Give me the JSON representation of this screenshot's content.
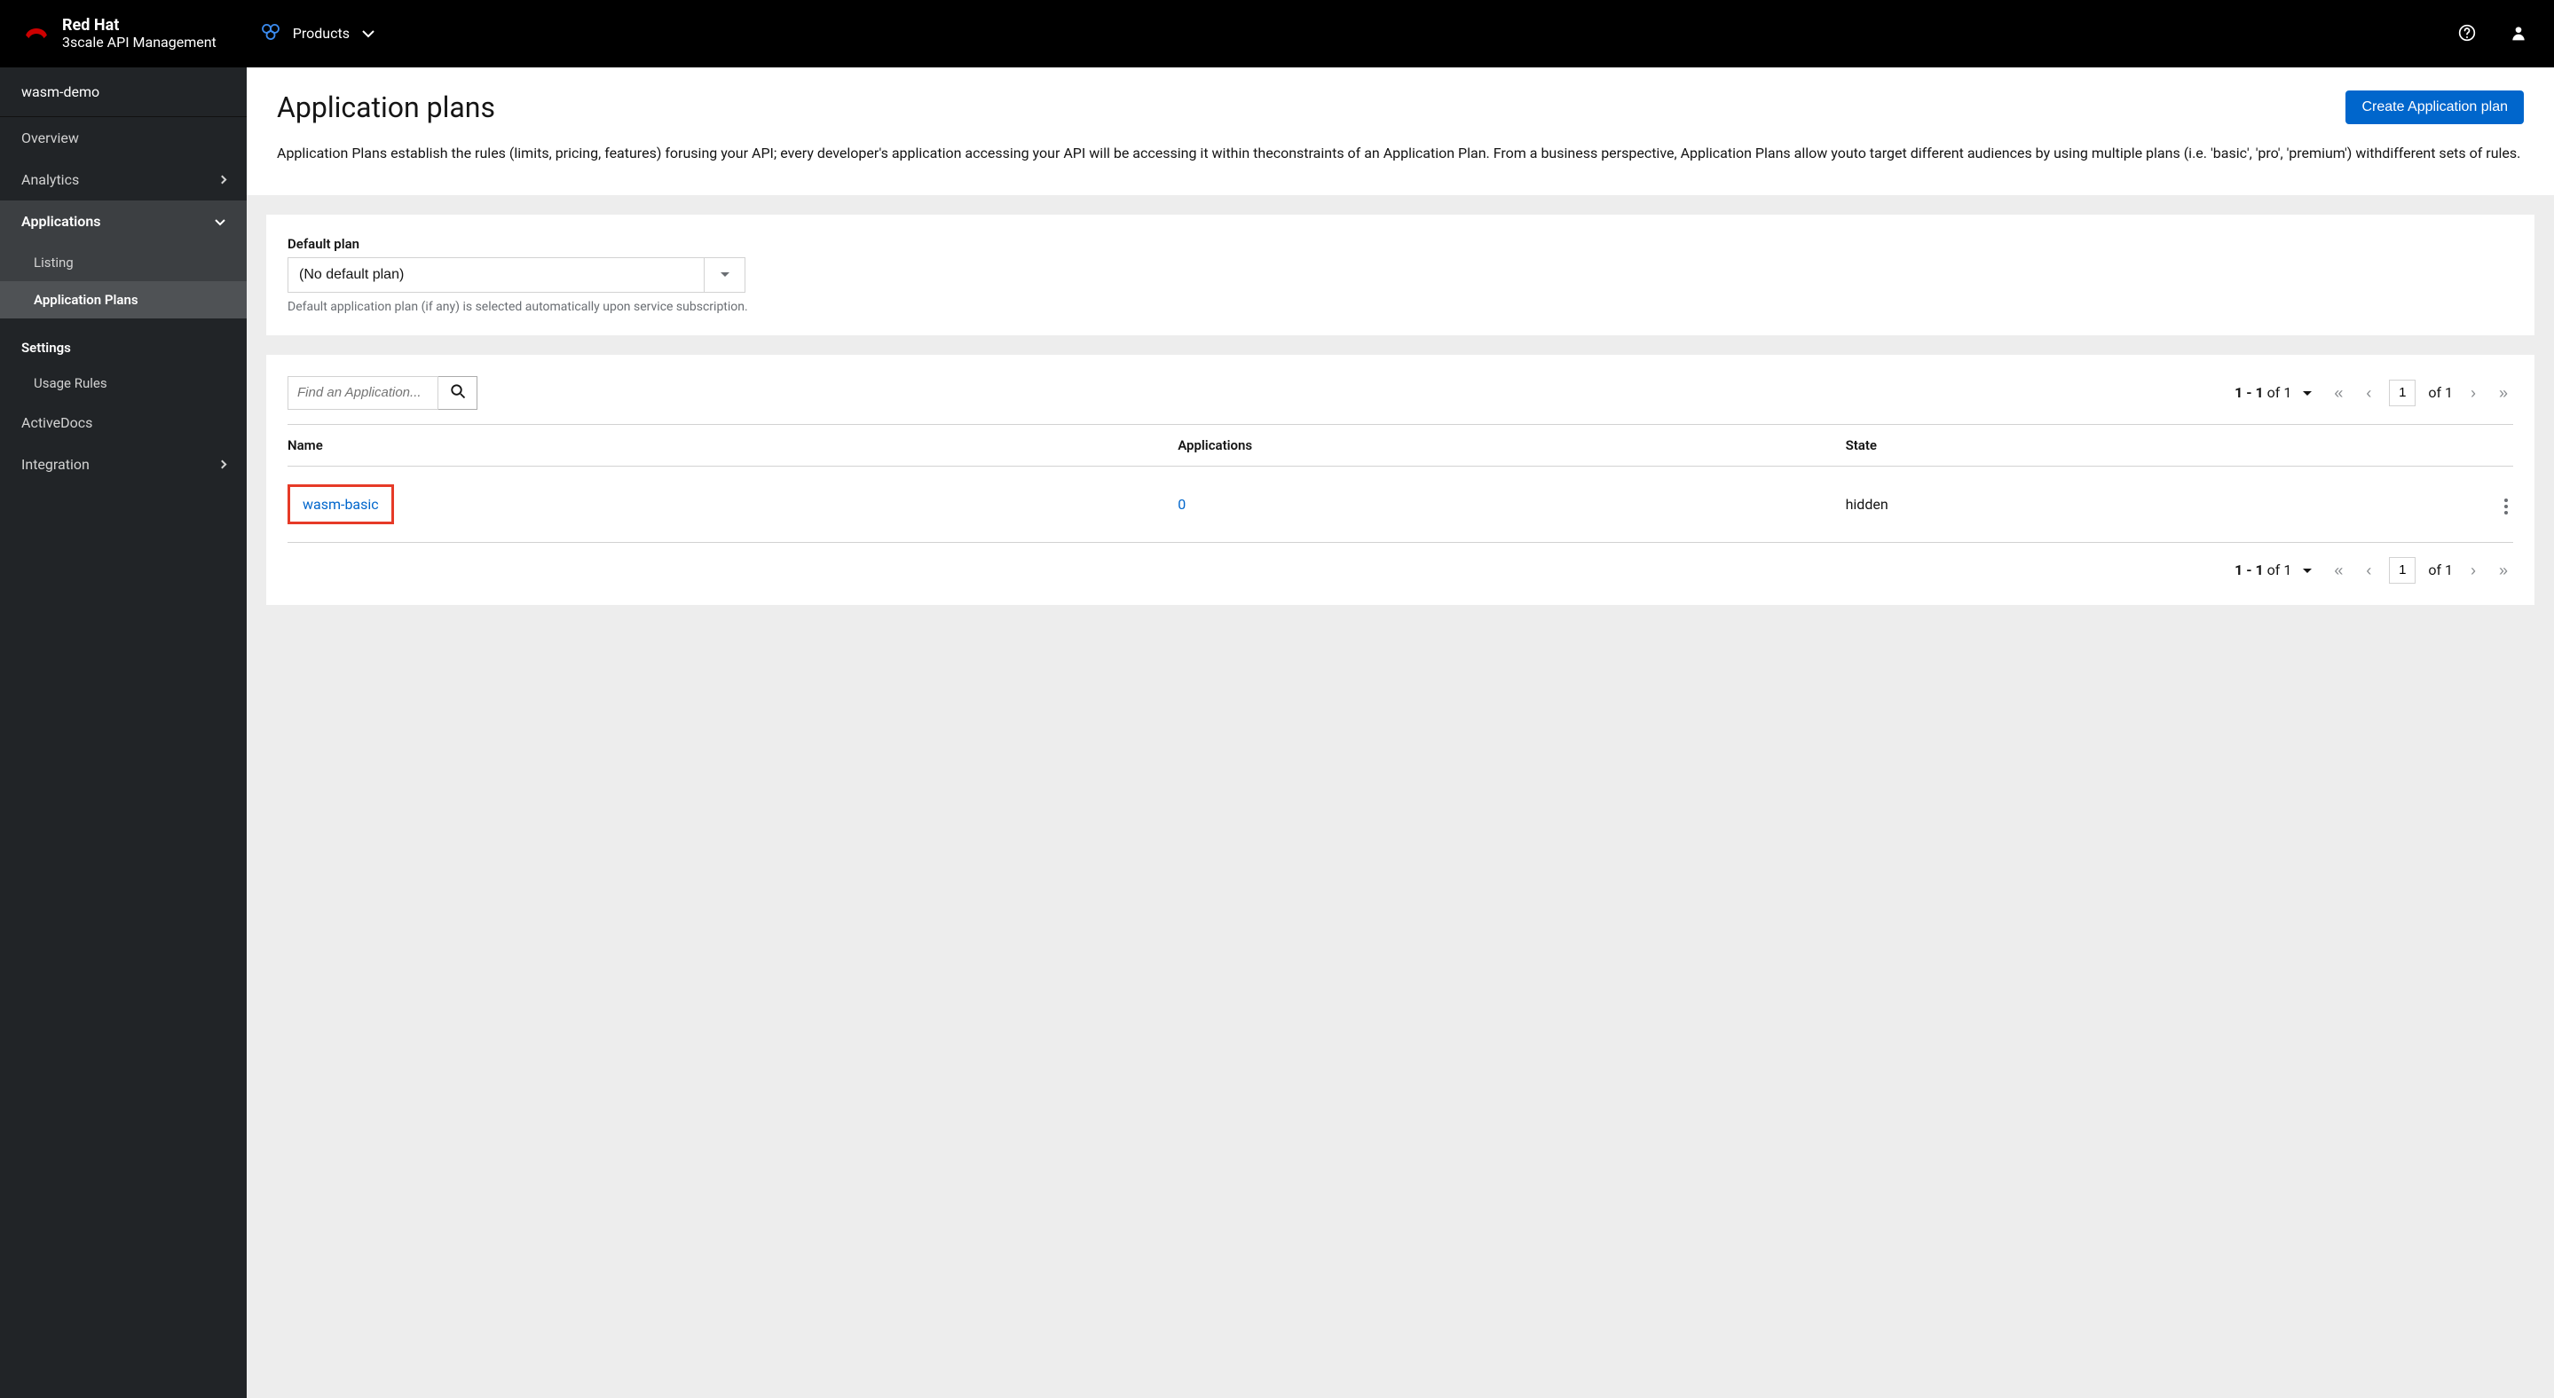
{
  "header": {
    "brand_top": "Red Hat",
    "brand_bottom": "3scale API Management",
    "nav_products": "Products"
  },
  "sidebar": {
    "context": "wasm-demo",
    "overview": "Overview",
    "analytics": "Analytics",
    "applications": "Applications",
    "app_listing": "Listing",
    "app_plans": "Application Plans",
    "settings_label": "Settings",
    "usage_rules": "Usage Rules",
    "activedocs": "ActiveDocs",
    "integration": "Integration"
  },
  "page": {
    "title": "Application plans",
    "create_btn": "Create Application plan",
    "description": "Application Plans establish the rules (limits, pricing, features) forusing your API; every developer's application accessing your API will be accessing it within theconstraints of an Application Plan. From a business perspective, Application Plans allow youto target different audiences by using multiple plans (i.e. 'basic', 'pro', 'premium') withdifferent sets of rules."
  },
  "default_plan": {
    "label": "Default plan",
    "value": "(No default plan)",
    "help": "Default application plan (if any) is selected automatically upon service subscription."
  },
  "search": {
    "placeholder": "Find an Application..."
  },
  "pagination": {
    "range": "1 - 1",
    "of_word": "of",
    "total": "1",
    "page": "1",
    "page_of": "of 1"
  },
  "table": {
    "col_name": "Name",
    "col_apps": "Applications",
    "col_state": "State",
    "rows": [
      {
        "name": "wasm-basic",
        "apps": "0",
        "state": "hidden"
      }
    ]
  }
}
